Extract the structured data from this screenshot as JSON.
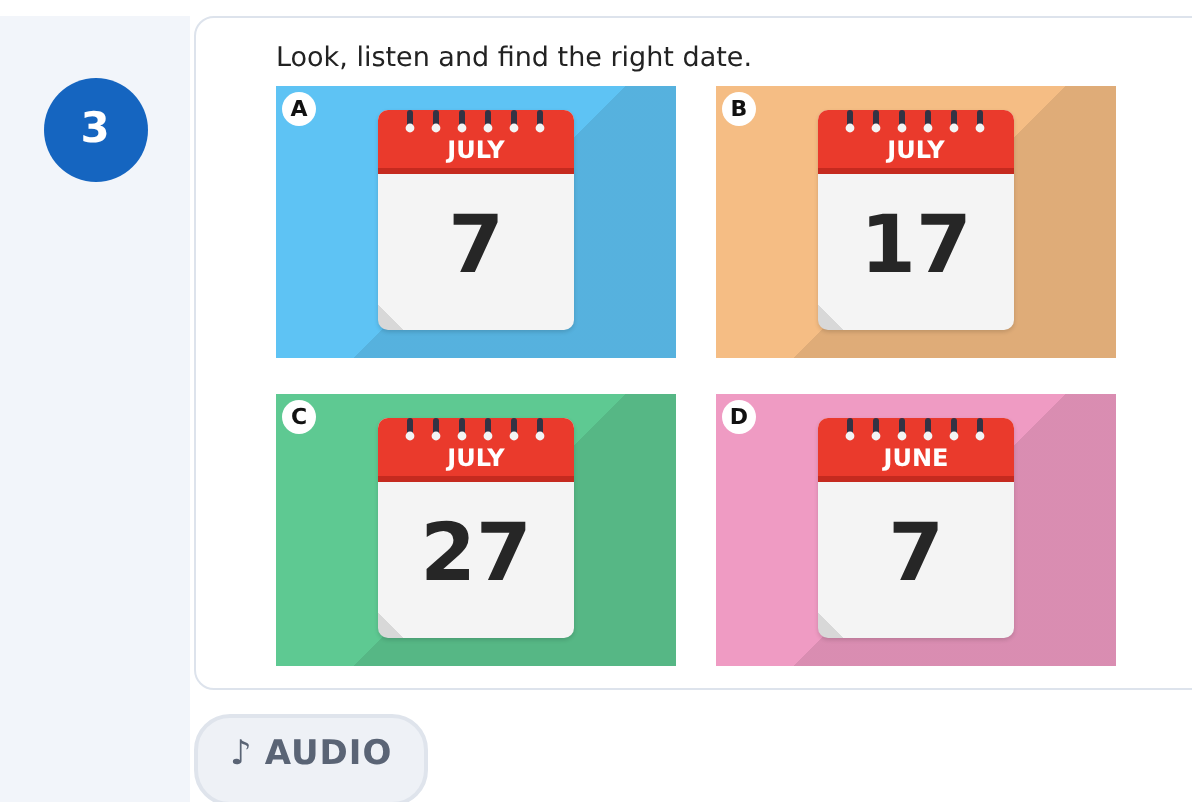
{
  "question_number": "3",
  "instruction": "Look, listen and find the right date.",
  "options": [
    {
      "letter": "A",
      "month": "JULY",
      "day": "7",
      "color": "#5ec3f4"
    },
    {
      "letter": "B",
      "month": "JULY",
      "day": "17",
      "color": "#f5bd84"
    },
    {
      "letter": "C",
      "month": "JULY",
      "day": "27",
      "color": "#5ec992"
    },
    {
      "letter": "D",
      "month": "JUNE",
      "day": "7",
      "color": "#ef9bc3"
    }
  ],
  "audio_button": {
    "icon": "♪",
    "label": "AUDIO"
  }
}
